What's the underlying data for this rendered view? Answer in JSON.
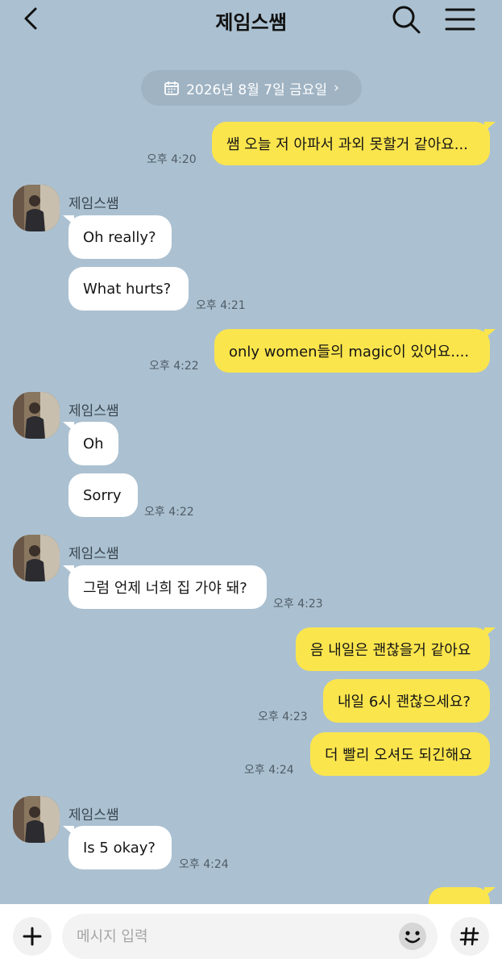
{
  "header": {
    "title": "제임스쌤",
    "back_icon": "chevron-left-icon",
    "search_icon": "search-icon",
    "menu_icon": "menu-icon"
  },
  "date_divider": {
    "label": "2026년 8월 7일 금요일",
    "icon": "calendar-icon",
    "chevron": "›"
  },
  "messages": [
    {
      "from": "me",
      "text": "쌤 오늘 저 아파서 과외 못할거 같아요...",
      "time": "오후 4:20"
    },
    {
      "from": "them",
      "sender": "제임스쌤",
      "text": "Oh really?"
    },
    {
      "from": "them",
      "text": "What hurts?",
      "time": "오후 4:21"
    },
    {
      "from": "me",
      "text": "only women들의 magic이 있어요....",
      "time": "오후 4:22"
    },
    {
      "from": "them",
      "sender": "제임스쌤",
      "text": "Oh"
    },
    {
      "from": "them",
      "text": "Sorry",
      "time": "오후 4:22"
    },
    {
      "from": "them",
      "sender": "제임스쌤",
      "text": "그럼 언제 너희 집 가야 돼?",
      "time": "오후 4:23"
    },
    {
      "from": "me",
      "text": "음 내일은 괜찮을거 같아요"
    },
    {
      "from": "me",
      "text": "내일 6시 괜찮으세요?",
      "time": "오후 4:23"
    },
    {
      "from": "me",
      "text": "더 빨리 오셔도 되긴해요",
      "time": "오후 4:24"
    },
    {
      "from": "them",
      "sender": "제임스쌤",
      "text": "Is 5 okay?",
      "time": "오후 4:24"
    }
  ],
  "input": {
    "placeholder": "메시지 입력",
    "plus_icon": "plus-icon",
    "emoji_icon": "emoji-icon",
    "hash_icon": "hash-icon"
  },
  "colors": {
    "background": "#abc1d1",
    "my_bubble": "#fbe54d",
    "their_bubble": "#ffffff"
  }
}
